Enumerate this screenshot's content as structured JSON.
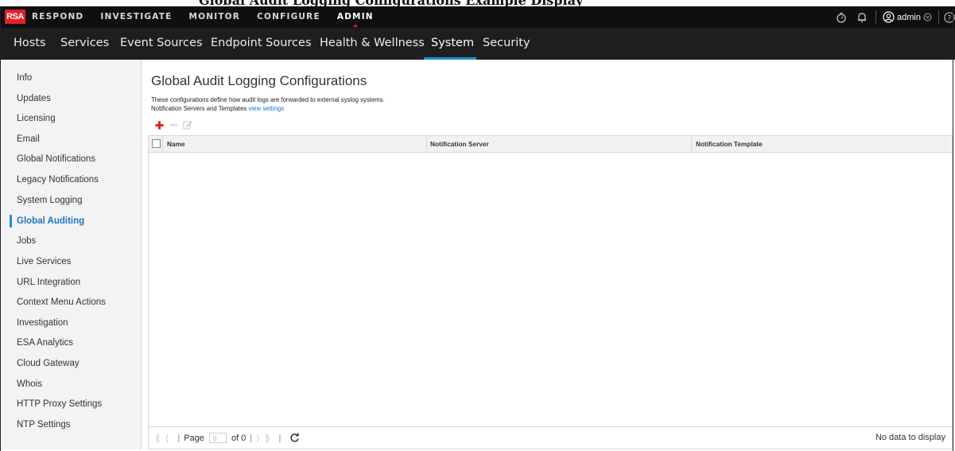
{
  "header": {
    "logo": "RSA",
    "nav": [
      "RESPOND",
      "INVESTIGATE",
      "MONITOR",
      "CONFIGURE",
      "ADMIN"
    ],
    "active_nav": "ADMIN",
    "user": "admin",
    "icons": [
      "timer-icon",
      "bell-icon",
      "user-icon",
      "chevron-down-icon",
      "help-icon"
    ]
  },
  "subnav": {
    "tabs": [
      "Hosts",
      "Services",
      "Event Sources",
      "Endpoint Sources",
      "Health & Wellness",
      "System",
      "Security"
    ],
    "active": "System"
  },
  "sidebar": {
    "items": [
      "Info",
      "Updates",
      "Licensing",
      "Email",
      "Global Notifications",
      "Legacy Notifications",
      "System Logging",
      "Global Auditing",
      "Jobs",
      "Live Services",
      "URL Integration",
      "Context Menu Actions",
      "Investigation",
      "ESA Analytics",
      "Cloud Gateway",
      "Whois",
      "HTTP Proxy Settings",
      "NTP Settings"
    ],
    "active": "Global Auditing"
  },
  "page": {
    "title": "Global Audit Logging Configurations",
    "description": "These configurations define how audit logs are forwarded to external syslog systems.",
    "servers_text": "Notification Servers and Templates",
    "view_settings_link": "view settings"
  },
  "grid": {
    "columns": [
      "Name",
      "Notification Server",
      "Notification Template"
    ],
    "rows": []
  },
  "footer": {
    "page_label": "Page",
    "page_value": "0",
    "of_label": "of 0",
    "no_data": "No data to display"
  },
  "colors": {
    "accent": "#1c8fd6",
    "brand_red": "#e31f26",
    "topbar": "#0f0f11",
    "subnav": "#1e1e1e"
  }
}
